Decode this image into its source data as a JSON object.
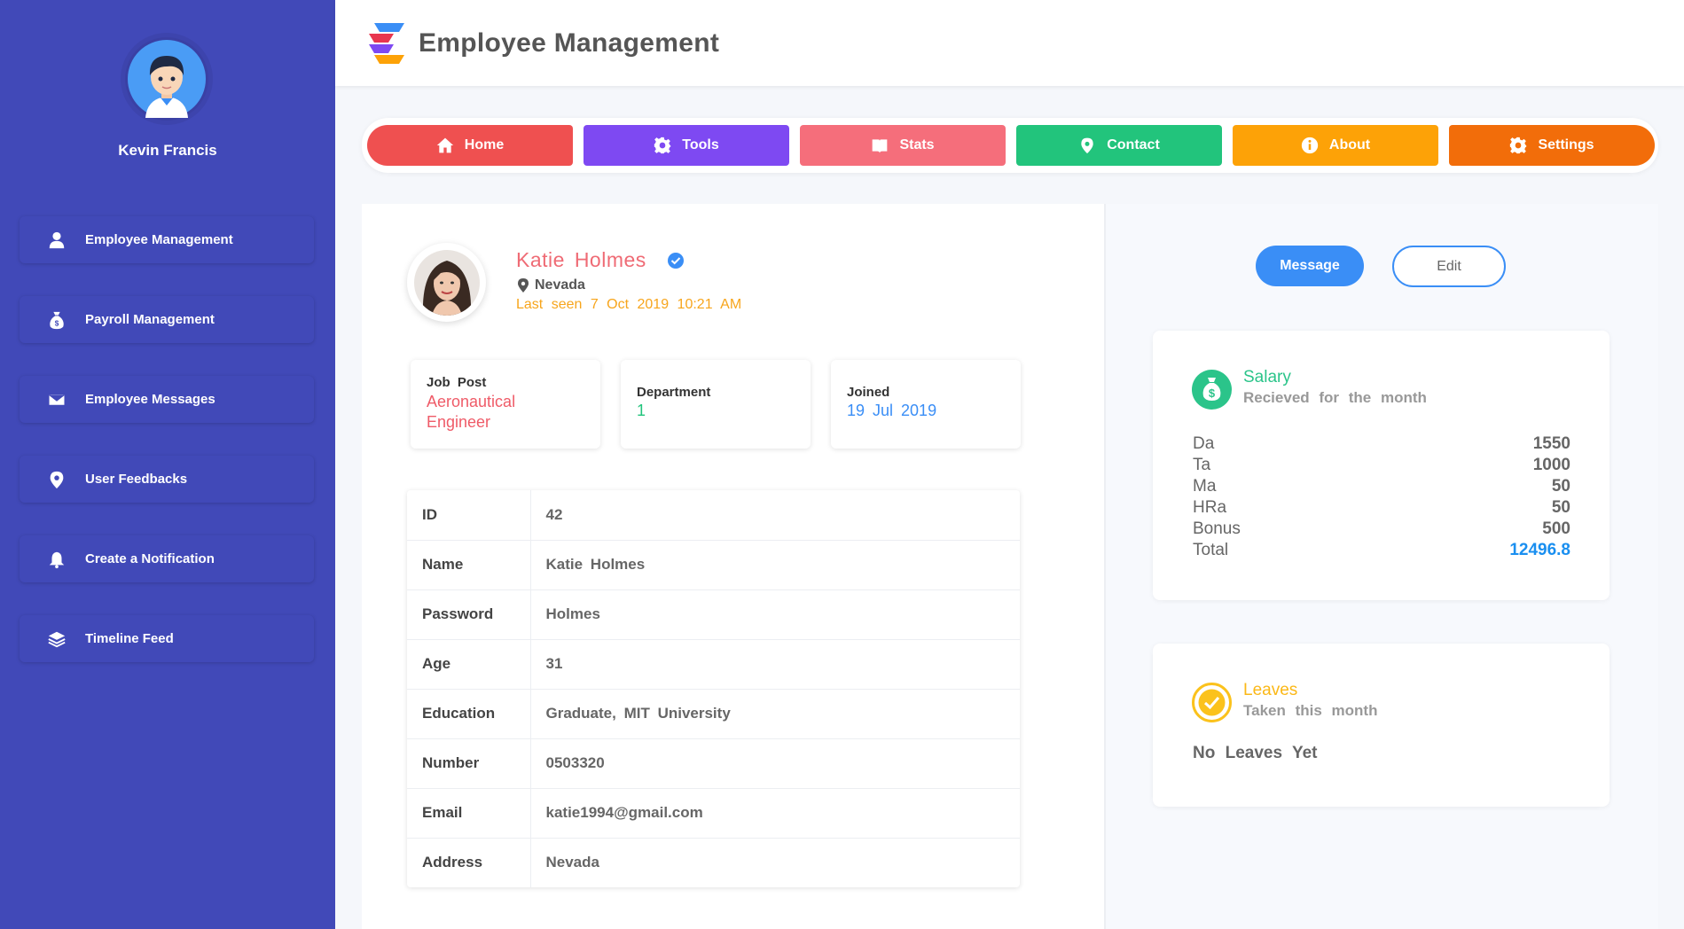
{
  "sidebar": {
    "user_name": "Kevin Francis",
    "items": [
      {
        "label": "Employee Management",
        "icon": "user-icon"
      },
      {
        "label": "Payroll Management",
        "icon": "money-bag-icon"
      },
      {
        "label": "Employee Messages",
        "icon": "envelope-icon"
      },
      {
        "label": "User Feedbacks",
        "icon": "map-pin-icon"
      },
      {
        "label": "Create a Notification",
        "icon": "bell-icon"
      },
      {
        "label": "Timeline Feed",
        "icon": "layers-icon"
      }
    ],
    "color": "#4149b8"
  },
  "header": {
    "title": "Employee Management"
  },
  "nav": [
    {
      "label": "Home",
      "color": "#ef5050",
      "icon": "home-icon"
    },
    {
      "label": "Tools",
      "color": "#7e49f2",
      "icon": "gear-icon"
    },
    {
      "label": "Stats",
      "color": "#f56e7b",
      "icon": "book-icon"
    },
    {
      "label": "Contact",
      "color": "#22c47c",
      "icon": "map-pin-icon"
    },
    {
      "label": "About",
      "color": "#fda207",
      "icon": "info-icon"
    },
    {
      "label": "Settings",
      "color": "#f26d0a",
      "icon": "gear-icon"
    }
  ],
  "profile": {
    "name": "Katie  Holmes",
    "location": "Nevada",
    "last_seen": "Last  seen  7  Oct  2019  10:21  AM",
    "job_post_label": "Job  Post",
    "job_post_value": "Aeronautical Engineer",
    "department_label": "Department",
    "department_value": "1",
    "joined_label": "Joined",
    "joined_value": "19  Jul  2019"
  },
  "details": [
    {
      "key": "ID",
      "value": "42"
    },
    {
      "key": "Name",
      "value": "Katie  Holmes"
    },
    {
      "key": "Password",
      "value": "Holmes"
    },
    {
      "key": "Age",
      "value": "31"
    },
    {
      "key": "Education",
      "value": "Graduate,  MIT  University"
    },
    {
      "key": "Number",
      "value": "0503320"
    },
    {
      "key": "Email",
      "value": "katie1994@gmail.com"
    },
    {
      "key": "Address",
      "value": "Nevada"
    }
  ],
  "actions": {
    "message": "Message",
    "edit": "Edit"
  },
  "salary": {
    "title": "Salary",
    "subtitle": "Recieved  for  the  month",
    "rows": [
      {
        "label": "Da",
        "value": "1550"
      },
      {
        "label": "Ta",
        "value": "1000"
      },
      {
        "label": "Ma",
        "value": "50"
      },
      {
        "label": "HRa",
        "value": "50"
      },
      {
        "label": "Bonus",
        "value": "500"
      },
      {
        "label": "Total",
        "value": "12496.8"
      }
    ]
  },
  "leaves": {
    "title": "Leaves",
    "subtitle": "Taken  this  month",
    "status": "No  Leaves  Yet"
  }
}
